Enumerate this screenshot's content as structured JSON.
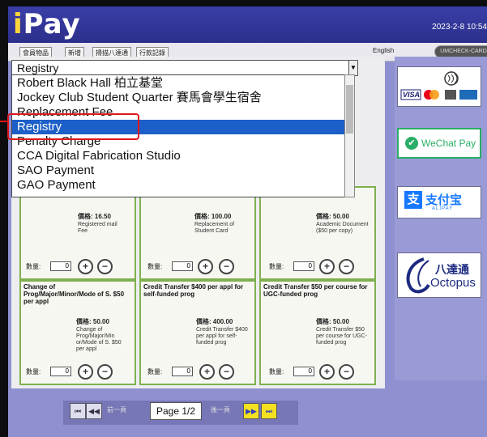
{
  "app": {
    "logo": "Pay",
    "datetime": "2023-2-8 10:54"
  },
  "menu": {
    "tabs": [
      "會員物品",
      "新增",
      "掃描八達通",
      "行款記錄"
    ],
    "lang_button": "English",
    "pill_label": "UMCHECK-CARD"
  },
  "dropdown": {
    "selected": "Registry",
    "options": [
      "Robert Black Hall 柏立基堂",
      "Jockey Club Student Quarter 賽馬會學生宿舍",
      "Replacement Fee",
      "Registry",
      "Penalty Charge",
      "CCA Digital Fabrication Studio",
      "SAO Payment",
      "GAO Payment"
    ],
    "highlighted_index": 3
  },
  "cards": [
    {
      "title": "",
      "price": "價格: 16.50",
      "desc": "Registered mail Fee",
      "qty_label": "數量:",
      "qty": "0"
    },
    {
      "title": "",
      "price": "價格: 100.00",
      "desc": "Replacement of Student Card",
      "qty_label": "數量:",
      "qty": "0"
    },
    {
      "title": "",
      "price": "價格: 50.00",
      "desc": "Academic Document ($50 per copy)",
      "qty_label": "數量:",
      "qty": "0"
    },
    {
      "title": "Change of Prog/Major/Minor/Mode of S. $50 per appl",
      "price": "價格: 50.00",
      "desc": "Change of Prog/Major/Min or/Mode of S. $50 per appl",
      "qty_label": "數量:",
      "qty": "0"
    },
    {
      "title": "Credit Transfer $400 per appl for self-funded prog",
      "price": "價格: 400.00",
      "desc": "Credit Transfer $400 per appl for self-funded prog",
      "qty_label": "數量:",
      "qty": "0"
    },
    {
      "title": "Credit Transfer $50 per course for UGC-funded prog",
      "price": "價格: 50.00",
      "desc": "Credit Transfer $50 per course for UGC-funded prog",
      "qty_label": "數量:",
      "qty": "0"
    }
  ],
  "payments": {
    "visa": "VISA",
    "wechat": "WeChat Pay",
    "alipay_cn": "支付宝",
    "alipay_en": "ALIPAY",
    "octopus_cn": "八達通",
    "octopus_en": "Octopus"
  },
  "pager": {
    "prev_label": "前一頁",
    "page": "Page 1/2",
    "next_label": "後一頁"
  },
  "colors": {
    "accent_green": "#7fb04e",
    "selection_blue": "#1d5fc8",
    "highlight_red": "#e0161a",
    "wechat_green": "#2aae67",
    "alipay_blue": "#1678ff"
  }
}
